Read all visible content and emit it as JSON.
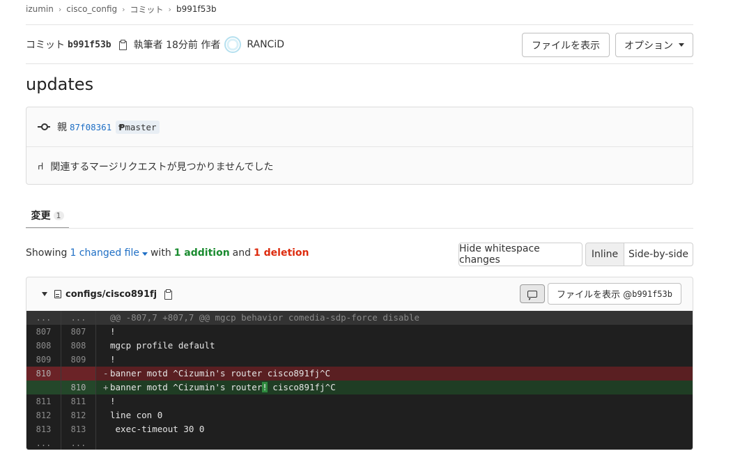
{
  "breadcrumb": {
    "items": [
      "izumin",
      "cisco_config",
      "コミット"
    ],
    "current": "b991f53b"
  },
  "commit": {
    "label": "コミット",
    "sha": "b991f53b",
    "author_prefix": "執筆者 18分前 作者",
    "author_name": "RANCiD",
    "title": "updates",
    "parent_label": "親",
    "parent_sha": "87f08361",
    "branch": "master",
    "mr_message": "関連するマージリクエストが見つかりませんでした"
  },
  "actions": {
    "view_files": "ファイルを表示",
    "options": "オプション"
  },
  "tabs": [
    {
      "label": "変更",
      "count": "1"
    }
  ],
  "diff_summary": {
    "showing": "Showing",
    "changed": "1 changed file",
    "with": "with",
    "additions": "1 addition",
    "and": "and",
    "deletions": "1 deletion"
  },
  "view_controls": {
    "hide_whitespace": "Hide whitespace changes",
    "inline": "Inline",
    "side_by_side": "Side-by-side"
  },
  "file": {
    "path": "configs/cisco891fj",
    "view_at": "ファイルを表示 @ ",
    "view_at_sha": "b991f53b"
  },
  "diff_lines": [
    {
      "type": "hunk",
      "old": "...",
      "new": "...",
      "sign": " ",
      "code": "@@ -807,7 +807,7 @@ mgcp behavior comedia-sdp-force disable"
    },
    {
      "type": "context",
      "old": "807",
      "new": "807",
      "sign": " ",
      "code": "!"
    },
    {
      "type": "context",
      "old": "808",
      "new": "808",
      "sign": " ",
      "code": "mgcp profile default"
    },
    {
      "type": "context",
      "old": "809",
      "new": "809",
      "sign": " ",
      "code": "!"
    },
    {
      "type": "del",
      "old": "810",
      "new": "",
      "sign": "-",
      "code": "banner motd ^Cizumin's router cisco891fj^C"
    },
    {
      "type": "add",
      "old": "",
      "new": "810",
      "sign": "+",
      "code_before": "banner motd ^Cizumin's router",
      "code_hl": "!",
      "code_after": " cisco891fj^C"
    },
    {
      "type": "context",
      "old": "811",
      "new": "811",
      "sign": " ",
      "code": "!"
    },
    {
      "type": "context",
      "old": "812",
      "new": "812",
      "sign": " ",
      "code": "line con 0"
    },
    {
      "type": "context",
      "old": "813",
      "new": "813",
      "sign": " ",
      "code": " exec-timeout 30 0"
    },
    {
      "type": "hunk-end",
      "old": "...",
      "new": "...",
      "sign": " ",
      "code": ""
    }
  ],
  "colors": {
    "link": "#1f6fc5",
    "addition": "#1a8b2f",
    "deletion": "#dd2b0e"
  }
}
